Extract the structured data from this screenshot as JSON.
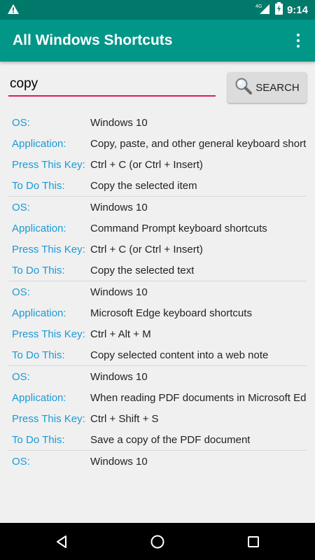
{
  "status_bar": {
    "time": "9:14",
    "network": "4G",
    "icons": [
      "warning-icon",
      "signal-icon",
      "battery-charging-icon"
    ]
  },
  "app_bar": {
    "title": "All Windows Shortcuts",
    "overflow_icon": "more-vert-icon"
  },
  "search": {
    "query": "copy",
    "button_label": "SEARCH",
    "button_icon": "magnifier-icon"
  },
  "labels": {
    "os": "OS:",
    "application": "Application:",
    "key": "Press This Key:",
    "action": "To Do This:"
  },
  "results": [
    {
      "os": "Windows 10",
      "application": "Copy, paste, and other general keyboard shortcuts",
      "key": "Ctrl + C (or Ctrl + Insert)",
      "action": "Copy the selected item"
    },
    {
      "os": "Windows 10",
      "application": "Command Prompt keyboard shortcuts",
      "key": "Ctrl + C (or Ctrl + Insert)",
      "action": "Copy the selected text"
    },
    {
      "os": "Windows 10",
      "application": "Microsoft Edge keyboard shortcuts",
      "key": "Ctrl + Alt + M",
      "action": "Copy selected content into a web note"
    },
    {
      "os": "Windows 10",
      "application": "When reading PDF documents in Microsoft Edge",
      "key": "Ctrl + Shift + S",
      "action": "Save a copy of the PDF document"
    },
    {
      "os": "Windows 10"
    }
  ],
  "colors": {
    "status_bar": "#00796b",
    "app_bar": "#009688",
    "accent": "#d81b60",
    "label": "#1a9ad6"
  },
  "nav_bar": {
    "icons": [
      "back-icon",
      "home-icon",
      "recents-icon"
    ]
  }
}
